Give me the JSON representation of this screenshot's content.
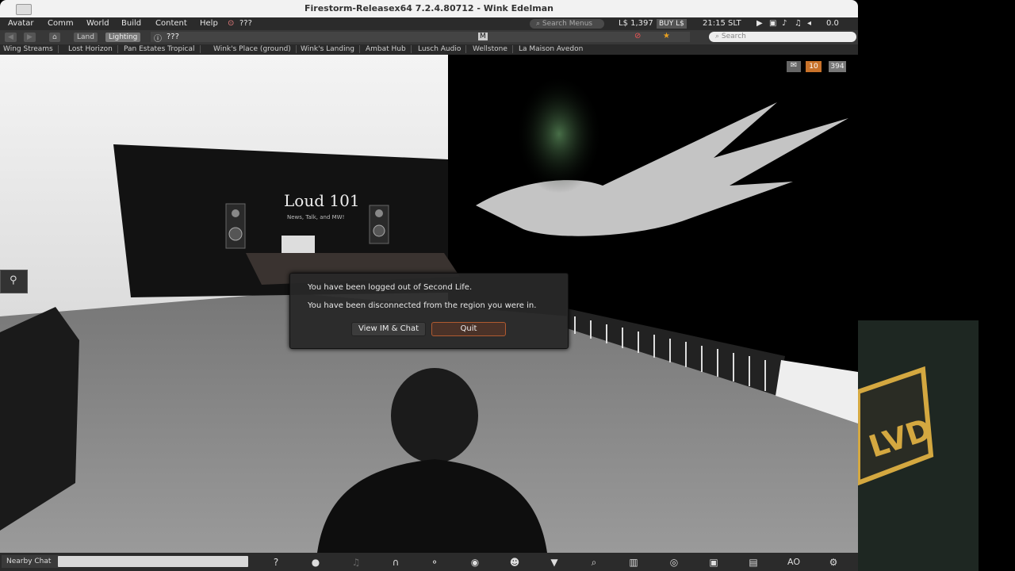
{
  "window": {
    "title": "Firestorm-Releasex64 7.2.4.80712 - Wink Edelman"
  },
  "menu": {
    "items": [
      "Avatar",
      "Comm",
      "World",
      "Build",
      "Content",
      "Help"
    ],
    "qmarks": "???",
    "search_menus_placeholder": "Search Menus",
    "balance": "L$ 1,397",
    "buy_label": "BUY L$",
    "time": "21:15 SLT",
    "fps": "0.0"
  },
  "navbar": {
    "land_label": "Land",
    "lighting_label": "Lighting",
    "location": "???",
    "m_label": "M",
    "search_placeholder": "Search"
  },
  "favorites": [
    "Wing Streams",
    "Lost Horizon",
    "Pan Estates Tropical",
    "Wink's Place (ground)",
    "Wink's Landing",
    "Ambat Hub",
    "Lusch Audio",
    "Wellstone",
    "La Maison Avedon"
  ],
  "overlay": {
    "notices_count": "10",
    "hud_value": "394"
  },
  "scene": {
    "sign_text": "Loud 101",
    "sign_subtext": "News, Talk, and MW!",
    "panel_text": "LVD"
  },
  "dialog": {
    "line1": "You have been logged out of Second Life.",
    "line2": "You have been disconnected from the region you were in.",
    "view_label": "View IM & Chat",
    "quit_label": "Quit"
  },
  "bottom": {
    "nearby_chat_label": "Nearby Chat",
    "ao_label": "AO"
  },
  "icons": [
    "home-icon",
    "info-icon",
    "search-icon",
    "map-pin-icon",
    "help-icon",
    "chat-bubble-icon",
    "microphone-icon",
    "headset-icon",
    "walk-icon",
    "eye-icon",
    "people-icon",
    "shirt-icon",
    "magnify-icon",
    "map-icon",
    "radar-icon",
    "camera-icon",
    "inventory-icon",
    "settings-icon"
  ]
}
